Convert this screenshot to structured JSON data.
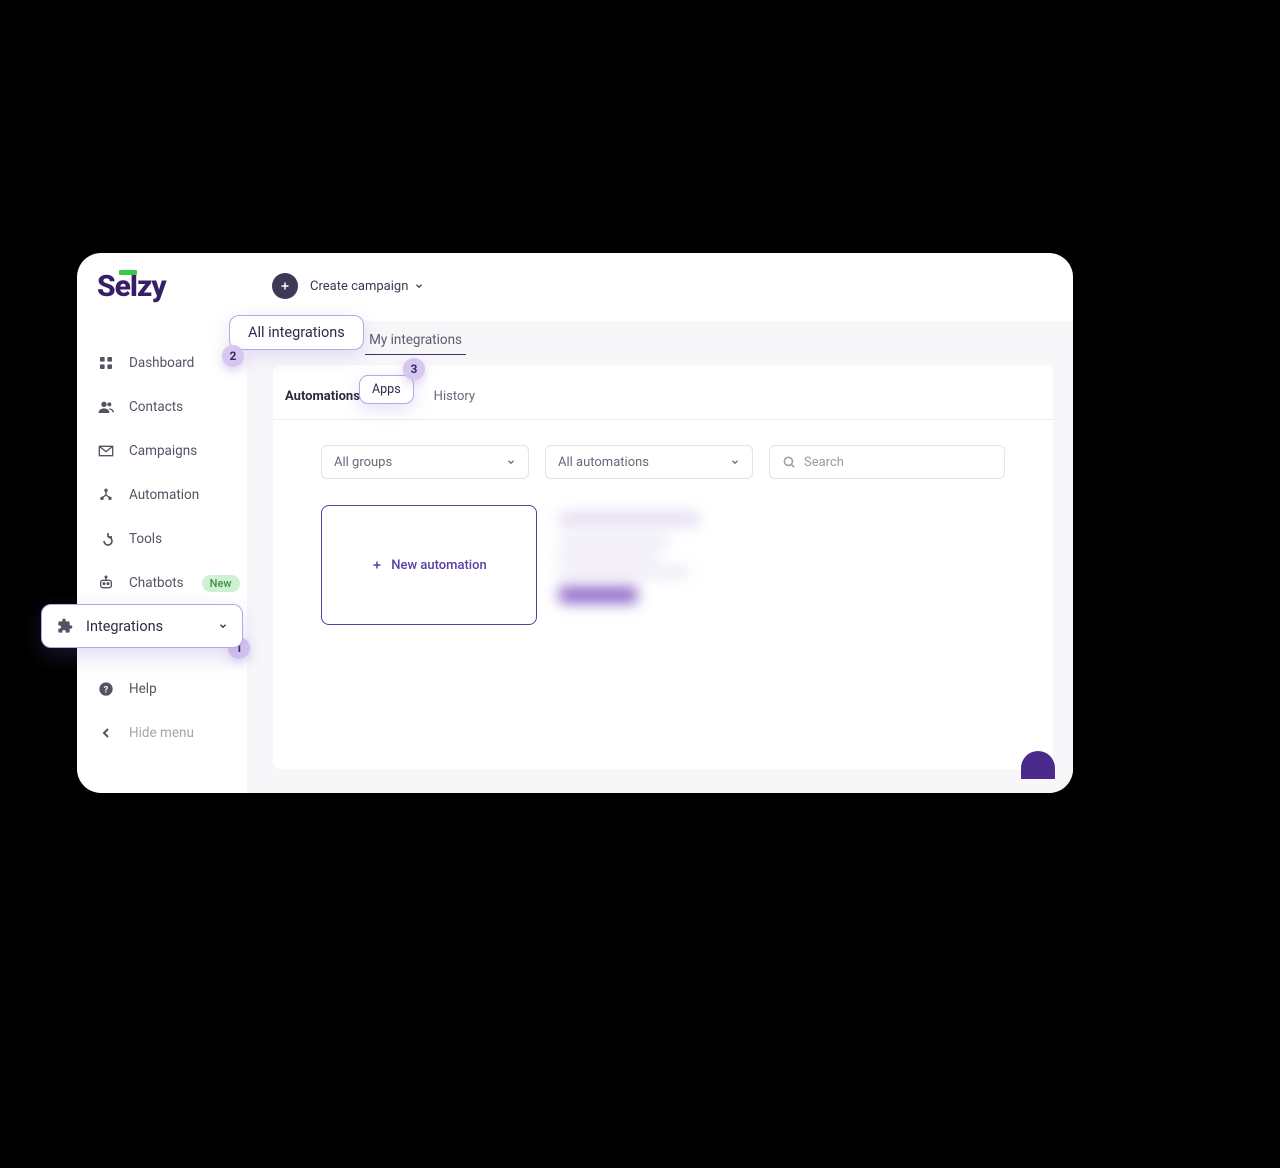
{
  "brand": {
    "name": "Selzy"
  },
  "header": {
    "create_campaign": "Create campaign"
  },
  "sidebar": {
    "items": [
      {
        "label": "Dashboard"
      },
      {
        "label": "Contacts"
      },
      {
        "label": "Campaigns"
      },
      {
        "label": "Automation"
      },
      {
        "label": "Tools"
      },
      {
        "label": "Chatbots",
        "badge": "New"
      },
      {
        "label": "Integrations"
      },
      {
        "label": "Help"
      },
      {
        "label": "Hide menu"
      }
    ]
  },
  "tabs": {
    "all_integrations": "All integrations",
    "my_integrations": "My integrations"
  },
  "subtabs": {
    "automations": "Automations",
    "apps": "Apps",
    "history": "History"
  },
  "filters": {
    "groups": "All groups",
    "automations": "All automations",
    "search_placeholder": "Search"
  },
  "actions": {
    "new_automation": "New automation"
  },
  "annotations": {
    "badge1": "1",
    "badge2": "2",
    "badge3": "3"
  }
}
